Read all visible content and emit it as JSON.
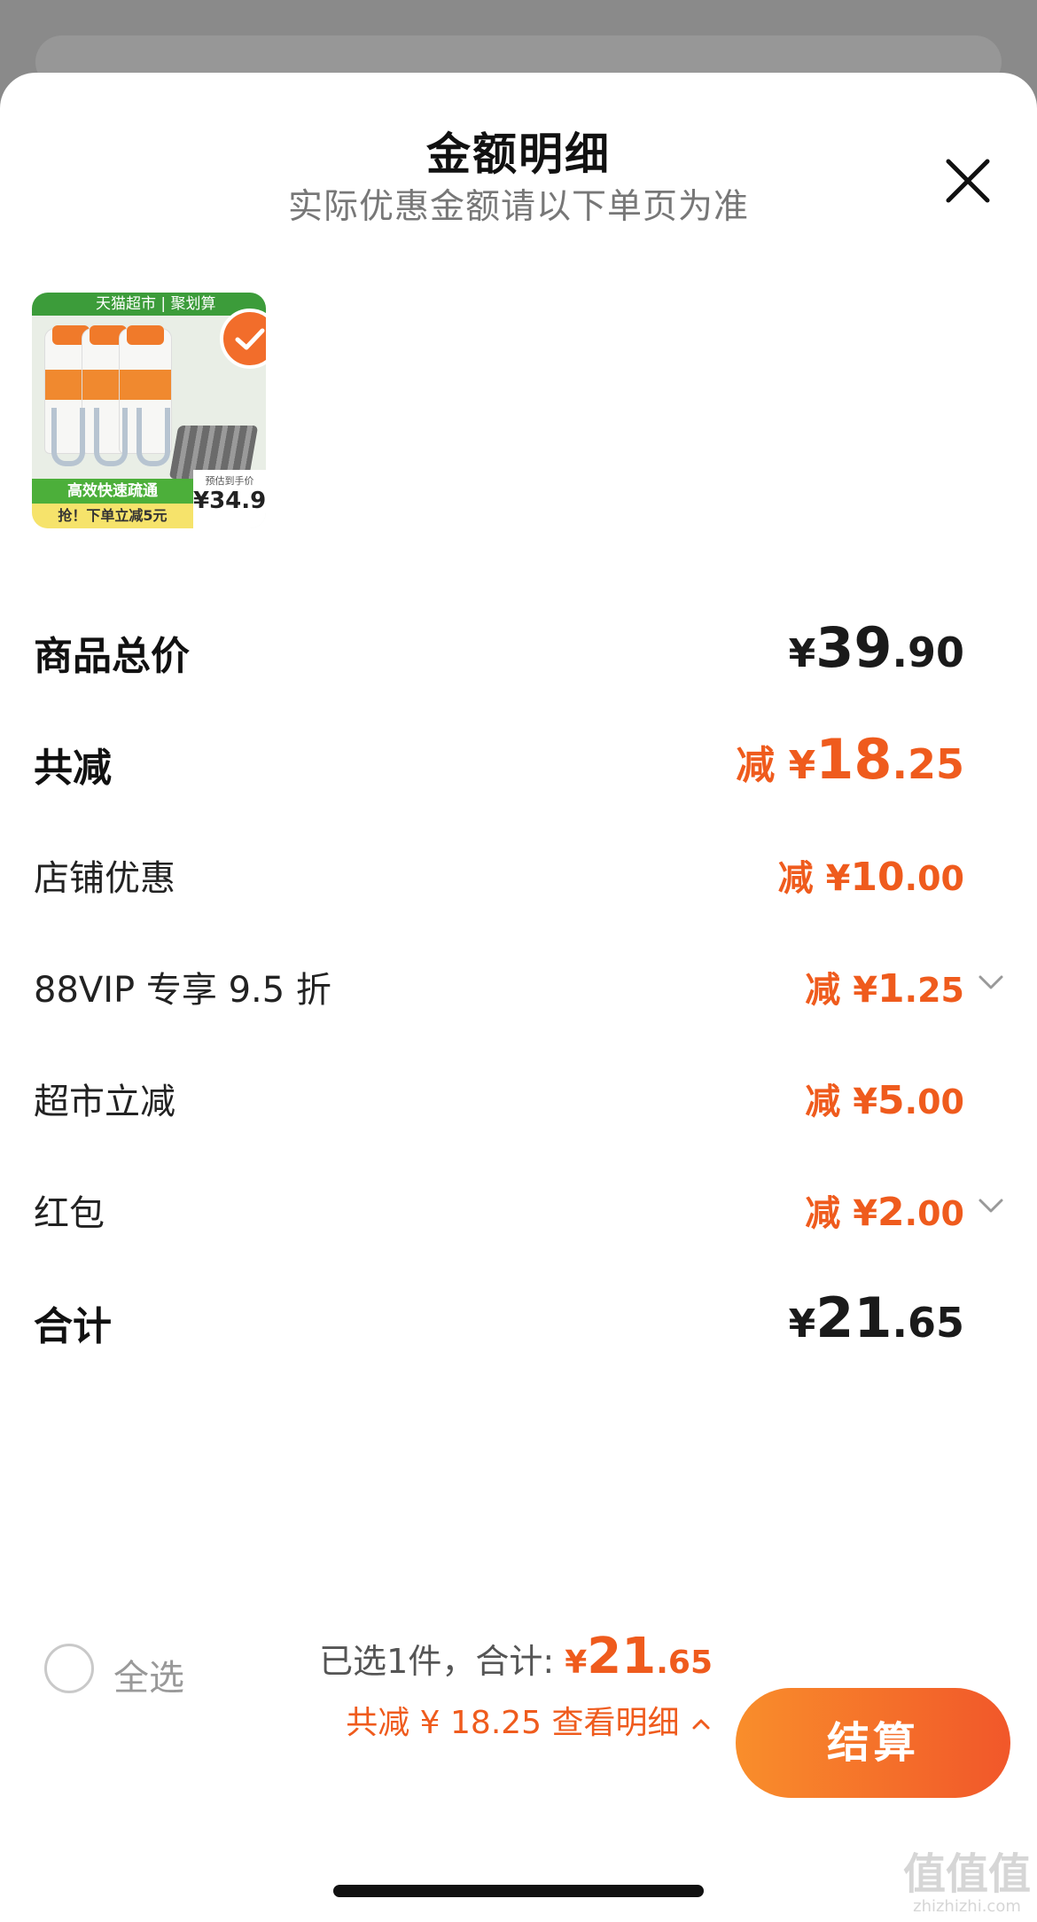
{
  "sheet": {
    "title": "金额明细",
    "subtitle": "实际优惠金额请以下单页为准"
  },
  "product": {
    "badge_top": "天猫超市 | 聚划算",
    "green_text": "高效快速疏通",
    "yellow_text": "抢！下单立减5元",
    "price_label": "预估到手价",
    "price_value": "¥34.9",
    "selected": true
  },
  "details": {
    "goods_total": {
      "label": "商品总价",
      "yen": "¥",
      "int": "39",
      "dec": ".90"
    },
    "total_discount": {
      "label": "共减",
      "prefix": "减 ",
      "yen": "¥",
      "int": "18",
      "dec": ".25"
    },
    "shop_discount": {
      "label": "店铺优惠",
      "prefix": "减 ",
      "yen": "¥",
      "int": "10",
      "dec": ".00"
    },
    "vip_discount": {
      "label": "88VIP 专享 9.5 折",
      "prefix": "减 ",
      "yen": "¥",
      "int": "1",
      "dec": ".25"
    },
    "market_discount": {
      "label": "超市立减",
      "prefix": "减 ",
      "yen": "¥",
      "int": "5",
      "dec": ".00"
    },
    "red_packet": {
      "label": "红包",
      "prefix": "减 ",
      "yen": "¥",
      "int": "2",
      "dec": ".00"
    },
    "sum": {
      "label": "合计",
      "yen": "¥",
      "int": "21",
      "dec": ".65"
    }
  },
  "bottom": {
    "select_all": "全选",
    "selected_text": "已选1件，合计:",
    "total_yen": "¥",
    "total_int": "21",
    "total_dec": ".65",
    "discount_text": "共减 ¥ 18.25",
    "view_detail": "查看明细",
    "checkout": "结算"
  },
  "watermark": {
    "main": "值值值",
    "url": "zhizhizhi.com"
  },
  "colors": {
    "accent": "#ef5b1d",
    "button_start": "#f98e2b",
    "button_end": "#f1572a"
  }
}
